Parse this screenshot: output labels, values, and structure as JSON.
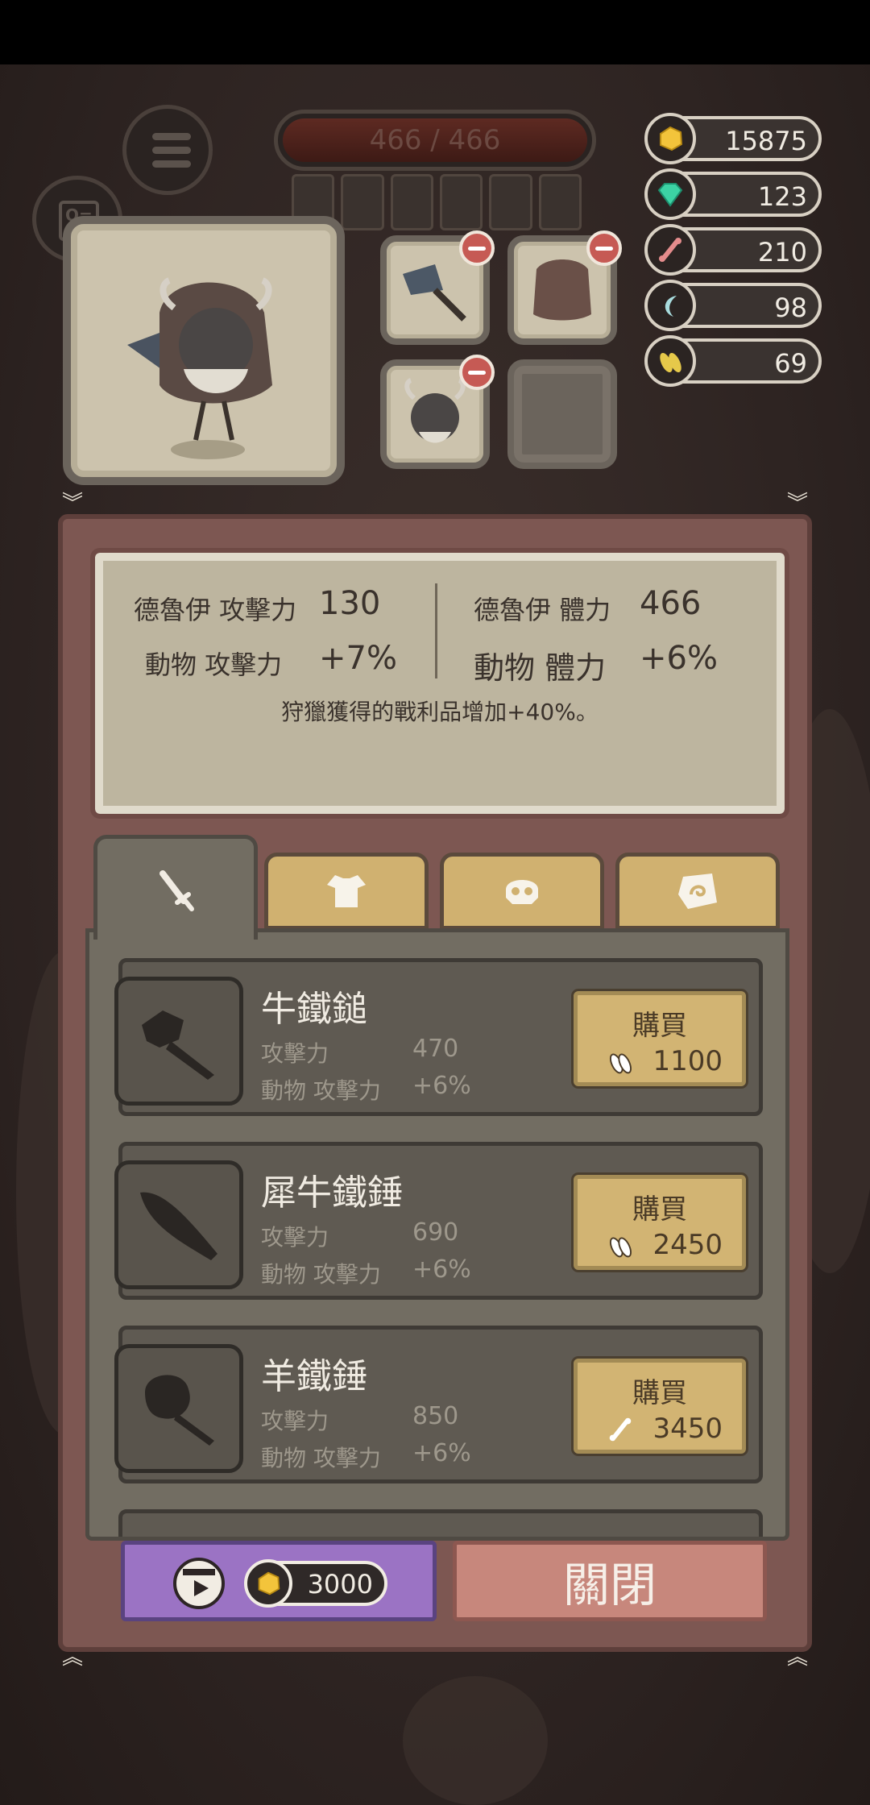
{
  "hud": {
    "hp_text": "466 / 466",
    "resources": [
      {
        "icon": "gold-nugget-icon",
        "value": "15875",
        "color": "#f3c43b"
      },
      {
        "icon": "gem-icon",
        "value": "123",
        "color": "#3cd2a4"
      },
      {
        "icon": "bone-icon",
        "value": "210",
        "color": "#e48c8c"
      },
      {
        "icon": "claw-icon",
        "value": "98",
        "color": "#a8dcde"
      },
      {
        "icon": "feather-icon",
        "value": "69",
        "color": "#e6c94a"
      }
    ]
  },
  "stats": {
    "druid_attack_label": "德魯伊 攻擊力",
    "druid_attack_value": "130",
    "druid_hp_label": "德魯伊 體力",
    "druid_hp_value": "466",
    "animal_attack_label": "動物 攻擊力",
    "animal_attack_value": "+7%",
    "animal_hp_label": "動物 體力",
    "animal_hp_value": "+6%",
    "note": "狩獵獲得的戰利品增加+40%。"
  },
  "tabs": [
    {
      "icon": "sword-icon",
      "active": true
    },
    {
      "icon": "armor-icon",
      "active": false
    },
    {
      "icon": "skull-helmet-icon",
      "active": false
    },
    {
      "icon": "rune-stone-icon",
      "active": false
    }
  ],
  "items": [
    {
      "name": "牛鐵鎚",
      "stat1_label": "攻擊力",
      "stat1_value": "470",
      "stat2_label": "動物 攻擊力",
      "stat2_value": "+6%",
      "buy_label": "購買",
      "price": "1100",
      "currency_icon": "feather-icon"
    },
    {
      "name": "犀牛鐵錘",
      "stat1_label": "攻擊力",
      "stat1_value": "690",
      "stat2_label": "動物 攻擊力",
      "stat2_value": "+6%",
      "buy_label": "購買",
      "price": "2450",
      "currency_icon": "feather-icon"
    },
    {
      "name": "羊鐵錘",
      "stat1_label": "攻擊力",
      "stat1_value": "850",
      "stat2_label": "動物 攻擊力",
      "stat2_value": "+6%",
      "buy_label": "購買",
      "price": "3450",
      "currency_icon": "bone-icon"
    }
  ],
  "footer": {
    "ad_reward": "3000",
    "close_label": "關閉"
  }
}
